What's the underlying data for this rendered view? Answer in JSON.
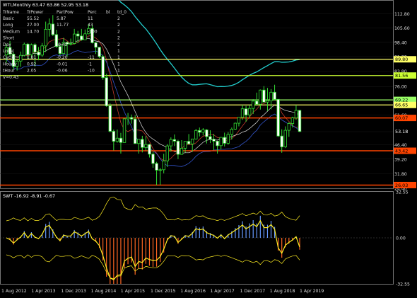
{
  "chart_data": [
    {
      "type": "candlestick",
      "title": "WTI,Monthly",
      "ohlc_readout": "63.47 63.86 52.95 53.18",
      "ylim": [
        24.4,
        119.5
      ],
      "y_ticks": [
        "112.80",
        "105.60",
        "98.40",
        "91.20",
        "83.80",
        "76.00",
        "68.80",
        "61.60",
        "53.10",
        "46.40",
        "39.20",
        "31.80",
        "24.40"
      ],
      "x_ticks": [
        "1 Aug 2012",
        "1 Apr 2013",
        "1 Dec 2013",
        "1 Aug 2014",
        "1 Apr 2015",
        "1 Dec 2015",
        "1 Aug 2016",
        "1 Apr 2017",
        "1 Dec 2017",
        "1 Aug 2018",
        "1 Apr 2019"
      ],
      "price_labels": [
        {
          "text": "89.80",
          "value": 89.8,
          "color": "#ffff66"
        },
        {
          "text": "81.56",
          "value": 81.56,
          "color": "#ccff33"
        },
        {
          "text": "69.22",
          "value": 69.22,
          "color": "#99ff66"
        },
        {
          "text": "66.65",
          "value": 66.65,
          "color": "#ffff66"
        },
        {
          "text": "60.07",
          "value": 60.07,
          "color": "#ff4400"
        },
        {
          "text": "53.18",
          "value": 53.18,
          "color": "#ffffff"
        },
        {
          "text": "43.42",
          "value": 43.42,
          "color": "#ff4400"
        },
        {
          "text": "26.03",
          "value": 26.03,
          "color": "#ff4400"
        }
      ],
      "candles": [
        {
          "o": 92.0,
          "h": 97.6,
          "l": 88.0,
          "c": 95.8
        },
        {
          "o": 95.8,
          "h": 99.1,
          "l": 91.2,
          "c": 92.4
        },
        {
          "o": 92.4,
          "h": 93.5,
          "l": 84.6,
          "c": 86.2
        },
        {
          "o": 86.2,
          "h": 89.8,
          "l": 84.1,
          "c": 88.9
        },
        {
          "o": 88.9,
          "h": 93.7,
          "l": 86.0,
          "c": 91.8
        },
        {
          "o": 91.8,
          "h": 98.2,
          "l": 91.3,
          "c": 97.5
        },
        {
          "o": 97.5,
          "h": 98.0,
          "l": 90.0,
          "c": 92.1
        },
        {
          "o": 92.1,
          "h": 97.8,
          "l": 90.2,
          "c": 97.2
        },
        {
          "o": 97.2,
          "h": 97.9,
          "l": 86.1,
          "c": 93.5
        },
        {
          "o": 93.5,
          "h": 96.0,
          "l": 89.3,
          "c": 91.9
        },
        {
          "o": 91.9,
          "h": 98.0,
          "l": 91.0,
          "c": 96.6
        },
        {
          "o": 96.6,
          "h": 108.9,
          "l": 93.5,
          "c": 105.0
        },
        {
          "o": 105.0,
          "h": 110.5,
          "l": 101.3,
          "c": 107.7
        },
        {
          "o": 107.7,
          "h": 112.2,
          "l": 101.6,
          "c": 102.3
        },
        {
          "o": 102.3,
          "h": 104.8,
          "l": 95.6,
          "c": 96.3
        },
        {
          "o": 96.3,
          "h": 97.9,
          "l": 91.8,
          "c": 92.7
        },
        {
          "o": 92.7,
          "h": 100.7,
          "l": 92.3,
          "c": 98.4
        },
        {
          "o": 98.4,
          "h": 98.8,
          "l": 91.2,
          "c": 97.5
        },
        {
          "o": 97.5,
          "h": 100.3,
          "l": 96.8,
          "c": 97.8
        },
        {
          "o": 97.8,
          "h": 105.2,
          "l": 97.4,
          "c": 102.6
        },
        {
          "o": 102.6,
          "h": 104.2,
          "l": 98.0,
          "c": 101.6
        },
        {
          "o": 101.6,
          "h": 105.2,
          "l": 99.2,
          "c": 99.7
        },
        {
          "o": 99.7,
          "h": 104.9,
          "l": 99.6,
          "c": 102.7
        },
        {
          "o": 102.7,
          "h": 107.7,
          "l": 102.5,
          "c": 105.4
        },
        {
          "o": 105.4,
          "h": 107.2,
          "l": 97.8,
          "c": 98.2
        },
        {
          "o": 98.2,
          "h": 98.7,
          "l": 92.5,
          "c": 95.9
        },
        {
          "o": 95.9,
          "h": 96.0,
          "l": 90.4,
          "c": 91.2
        },
        {
          "o": 91.2,
          "h": 92.0,
          "l": 79.4,
          "c": 80.5
        },
        {
          "o": 80.5,
          "h": 82.5,
          "l": 65.7,
          "c": 66.2
        },
        {
          "o": 66.2,
          "h": 67.5,
          "l": 52.7,
          "c": 53.3
        },
        {
          "o": 53.3,
          "h": 54.2,
          "l": 43.6,
          "c": 48.2
        },
        {
          "o": 48.2,
          "h": 54.2,
          "l": 47.5,
          "c": 49.8
        },
        {
          "o": 49.8,
          "h": 52.5,
          "l": 42.0,
          "c": 47.6
        },
        {
          "o": 47.6,
          "h": 59.9,
          "l": 47.5,
          "c": 59.6
        },
        {
          "o": 59.6,
          "h": 62.6,
          "l": 56.5,
          "c": 60.3
        },
        {
          "o": 60.3,
          "h": 61.8,
          "l": 57.2,
          "c": 59.5
        },
        {
          "o": 59.5,
          "h": 61.4,
          "l": 52.3,
          "c": 47.1
        },
        {
          "o": 47.1,
          "h": 49.0,
          "l": 42.0,
          "c": 49.2
        },
        {
          "o": 49.2,
          "h": 51.0,
          "l": 42.6,
          "c": 45.1
        },
        {
          "o": 45.1,
          "h": 50.9,
          "l": 43.6,
          "c": 46.6
        },
        {
          "o": 46.6,
          "h": 47.0,
          "l": 40.0,
          "c": 41.7
        },
        {
          "o": 41.7,
          "h": 43.0,
          "l": 34.8,
          "c": 37.0
        },
        {
          "o": 37.0,
          "h": 37.8,
          "l": 26.0,
          "c": 33.6
        },
        {
          "o": 33.6,
          "h": 34.7,
          "l": 26.1,
          "c": 33.8
        },
        {
          "o": 33.8,
          "h": 41.9,
          "l": 32.0,
          "c": 38.3
        },
        {
          "o": 38.3,
          "h": 46.8,
          "l": 35.2,
          "c": 45.9
        },
        {
          "o": 45.9,
          "h": 50.2,
          "l": 43.0,
          "c": 49.1
        },
        {
          "o": 49.1,
          "h": 51.7,
          "l": 45.8,
          "c": 48.3
        },
        {
          "o": 48.3,
          "h": 49.0,
          "l": 39.2,
          "c": 41.6
        },
        {
          "o": 41.6,
          "h": 48.8,
          "l": 41.4,
          "c": 44.7
        },
        {
          "o": 44.7,
          "h": 48.3,
          "l": 42.5,
          "c": 48.2
        },
        {
          "o": 48.2,
          "h": 51.9,
          "l": 47.2,
          "c": 46.9
        },
        {
          "o": 46.9,
          "h": 49.2,
          "l": 43.0,
          "c": 49.4
        },
        {
          "o": 49.4,
          "h": 54.5,
          "l": 49.2,
          "c": 53.7
        },
        {
          "o": 53.7,
          "h": 55.2,
          "l": 50.7,
          "c": 52.8
        },
        {
          "o": 52.8,
          "h": 54.9,
          "l": 51.2,
          "c": 54.0
        },
        {
          "o": 54.0,
          "h": 54.4,
          "l": 47.1,
          "c": 50.6
        },
        {
          "o": 50.6,
          "h": 53.8,
          "l": 47.3,
          "c": 49.3
        },
        {
          "o": 49.3,
          "h": 52.0,
          "l": 43.8,
          "c": 48.3
        },
        {
          "o": 48.3,
          "h": 47.5,
          "l": 42.0,
          "c": 46.0
        },
        {
          "o": 46.0,
          "h": 50.4,
          "l": 44.0,
          "c": 50.2
        },
        {
          "o": 50.2,
          "h": 52.6,
          "l": 45.6,
          "c": 47.2
        },
        {
          "o": 47.2,
          "h": 52.9,
          "l": 46.5,
          "c": 51.7
        },
        {
          "o": 51.7,
          "h": 55.2,
          "l": 49.1,
          "c": 54.4
        },
        {
          "o": 54.4,
          "h": 57.7,
          "l": 54.0,
          "c": 57.4
        },
        {
          "o": 57.4,
          "h": 60.5,
          "l": 55.8,
          "c": 60.4
        },
        {
          "o": 60.4,
          "h": 66.7,
          "l": 59.1,
          "c": 64.7
        },
        {
          "o": 64.7,
          "h": 66.2,
          "l": 58.1,
          "c": 61.6
        },
        {
          "o": 61.6,
          "h": 66.6,
          "l": 59.8,
          "c": 64.9
        },
        {
          "o": 64.9,
          "h": 69.6,
          "l": 62.1,
          "c": 68.6
        },
        {
          "o": 68.6,
          "h": 72.9,
          "l": 66.8,
          "c": 67.0
        },
        {
          "o": 67.0,
          "h": 74.5,
          "l": 64.3,
          "c": 74.2
        },
        {
          "o": 74.2,
          "h": 76.2,
          "l": 72.7,
          "c": 68.1
        },
        {
          "o": 68.1,
          "h": 75.3,
          "l": 63.6,
          "c": 68.8
        },
        {
          "o": 68.8,
          "h": 74.7,
          "l": 64.4,
          "c": 73.1
        },
        {
          "o": 73.1,
          "h": 76.9,
          "l": 71.8,
          "c": 69.5
        },
        {
          "o": 69.5,
          "h": 69.6,
          "l": 50.4,
          "c": 50.9
        },
        {
          "o": 50.9,
          "h": 54.3,
          "l": 42.4,
          "c": 45.4
        },
        {
          "o": 45.4,
          "h": 55.8,
          "l": 44.8,
          "c": 53.8
        },
        {
          "o": 53.8,
          "h": 57.8,
          "l": 50.5,
          "c": 57.2
        },
        {
          "o": 57.2,
          "h": 60.7,
          "l": 55.2,
          "c": 60.1
        },
        {
          "o": 60.1,
          "h": 66.6,
          "l": 59.2,
          "c": 63.9
        },
        {
          "o": 63.9,
          "h": 64.1,
          "l": 52.9,
          "c": 53.2
        }
      ]
    },
    {
      "type": "line",
      "title": "SWT -16.92 -8.91 -0.67",
      "ylim": [
        -32.55,
        32.55
      ],
      "y_ticks": [
        "32.55",
        "0.00",
        "-32.55"
      ]
    }
  ],
  "legend_table": {
    "headers": [
      "TrName",
      "TrPower",
      "PartPow",
      "Perc",
      "bl",
      "td_0"
    ],
    "rows": [
      [
        "Basic",
        "55.52",
        "5.87",
        "11",
        "",
        "2"
      ],
      [
        "Long",
        "27.00",
        "11.77",
        "43",
        "",
        "2"
      ],
      [
        "Medium",
        "14.70",
        "",
        "-100",
        "",
        "2"
      ],
      [
        "Short",
        "",
        "",
        "",
        "",
        "2"
      ],
      [
        "Day",
        "",
        "-0.42",
        "",
        "",
        "2"
      ],
      [
        "Local",
        "",
        "",
        "",
        "",
        "1"
      ],
      [
        "Cycle",
        "1.81",
        "-0.20",
        "-11",
        "",
        "1"
      ],
      [
        "Hourly",
        "0.92",
        "-0.01",
        "-1",
        "",
        "1"
      ],
      [
        "tHour",
        "2.05",
        "-0.06",
        "-10",
        "",
        "1"
      ],
      [
        "V=0.43",
        "",
        "",
        "",
        "",
        ""
      ]
    ]
  }
}
